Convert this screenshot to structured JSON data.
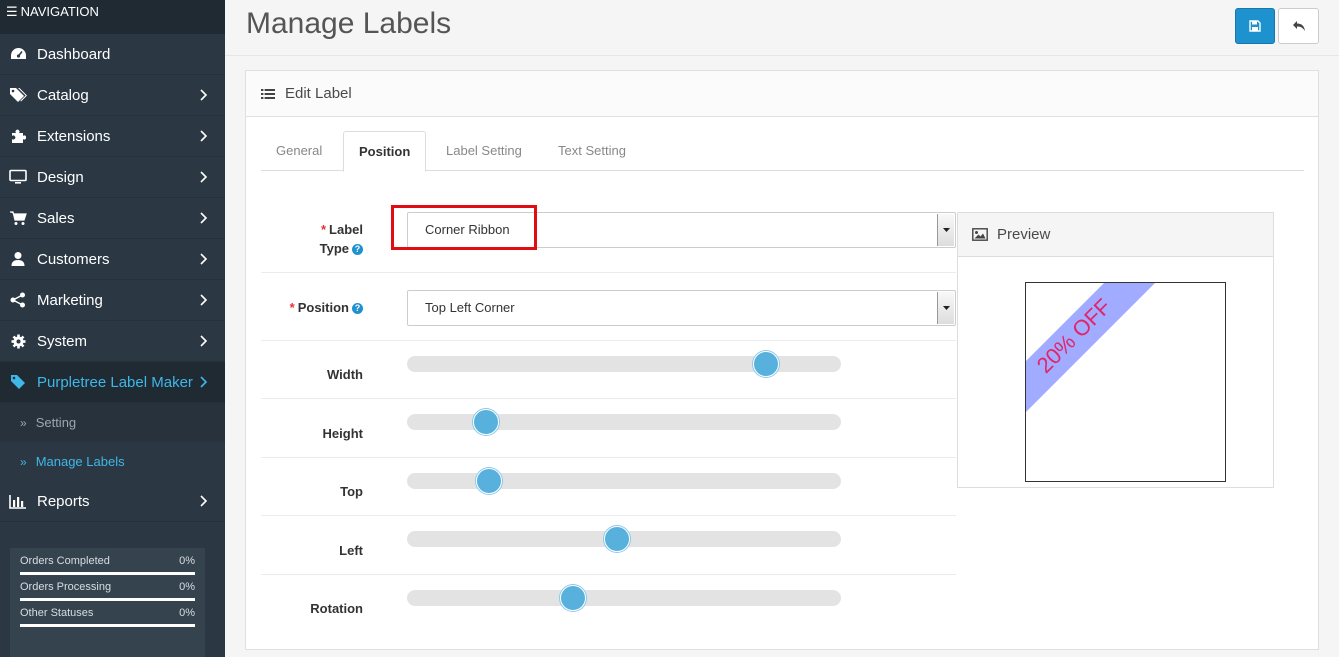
{
  "sidebar": {
    "header": "NAVIGATION",
    "items": [
      {
        "label": "Dashboard",
        "icon": "dashboard-icon"
      },
      {
        "label": "Catalog",
        "icon": "tags-icon"
      },
      {
        "label": "Extensions",
        "icon": "puzzle-icon"
      },
      {
        "label": "Design",
        "icon": "monitor-icon"
      },
      {
        "label": "Sales",
        "icon": "cart-icon"
      },
      {
        "label": "Customers",
        "icon": "user-icon"
      },
      {
        "label": "Marketing",
        "icon": "share-icon"
      },
      {
        "label": "System",
        "icon": "gear-icon"
      },
      {
        "label": "Purpletree Label Maker",
        "icon": "tag-icon"
      }
    ],
    "subitems": [
      {
        "label": "Setting"
      },
      {
        "label": "Manage Labels"
      }
    ],
    "reports": {
      "label": "Reports",
      "icon": "bar-chart-icon"
    },
    "stats": [
      {
        "label": "Orders Completed",
        "value": "0%"
      },
      {
        "label": "Orders Processing",
        "value": "0%"
      },
      {
        "label": "Other Statuses",
        "value": "0%"
      }
    ]
  },
  "header": {
    "title": "Manage Labels"
  },
  "panel": {
    "title": "Edit Label"
  },
  "tabs": [
    {
      "label": "General"
    },
    {
      "label": "Position"
    },
    {
      "label": "Label Setting"
    },
    {
      "label": "Text Setting"
    }
  ],
  "form": {
    "label_type": {
      "label_line1": "Label",
      "label_line2": "Type",
      "value": "Corner Ribbon"
    },
    "position": {
      "label": "Position",
      "value": "Top Left Corner"
    },
    "sliders": [
      {
        "label": "Width",
        "value": 0.827
      },
      {
        "label": "Height",
        "value": 0.182
      },
      {
        "label": "Top",
        "value": 0.189
      },
      {
        "label": "Left",
        "value": 0.484
      },
      {
        "label": "Rotation",
        "value": 0.382
      }
    ]
  },
  "preview": {
    "title": "Preview",
    "ribbon_text": "20% OFF"
  },
  "colors": {
    "accent": "#1e91cf",
    "ribbon": "#a1abff",
    "ribbon_text": "#e0266a"
  }
}
